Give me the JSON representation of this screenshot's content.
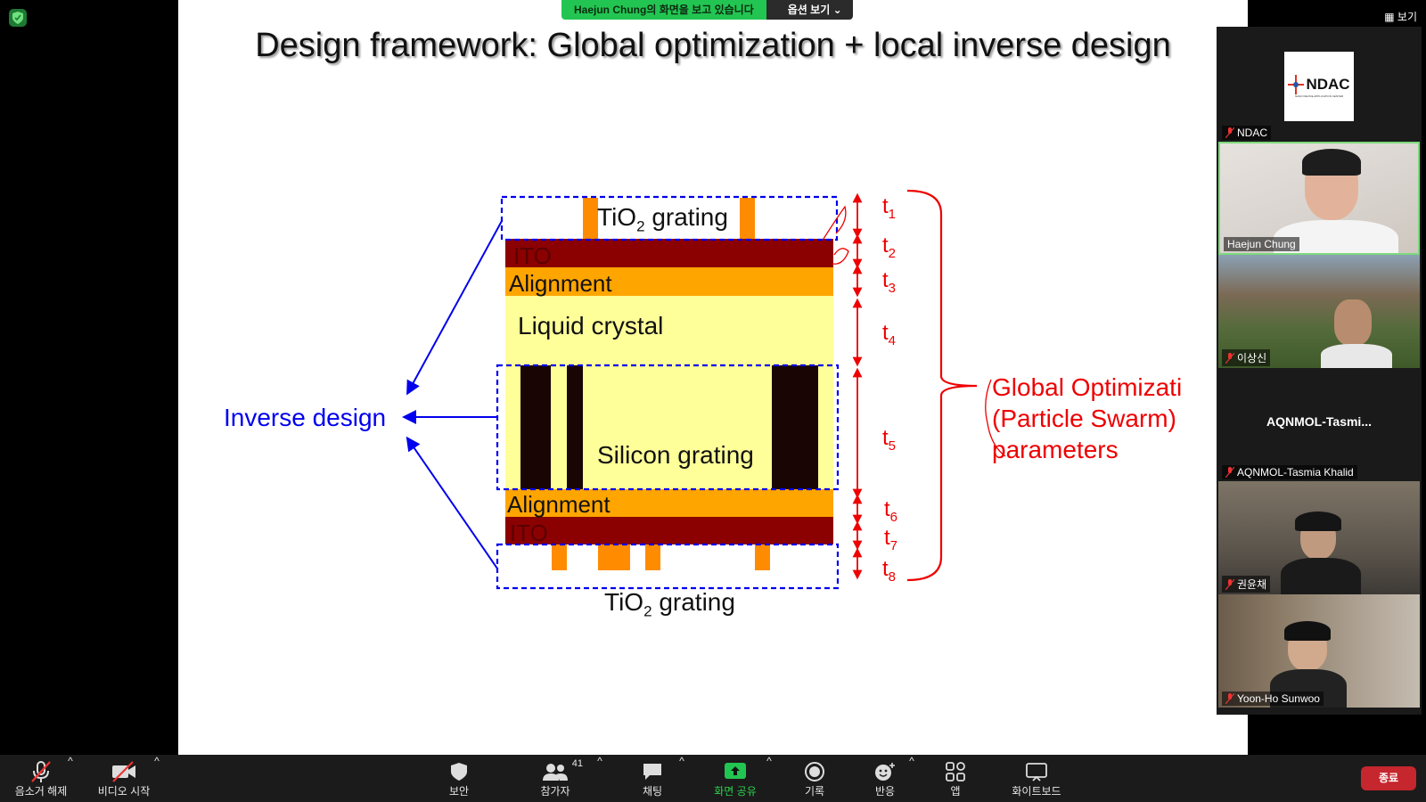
{
  "banner": {
    "share_text": "Haejun Chung의 화면을 보고 있습니다",
    "view_options": "옵션 보기"
  },
  "slide": {
    "title": "Design framework: Global optimization + local inverse design",
    "layers": {
      "tio2_top_pre": "TiO",
      "tio2_top_sub": "2",
      "tio2_top_post": " grating",
      "ito_top": "ITO",
      "alignment_top": "Alignment",
      "liquid_crystal": "Liquid crystal",
      "silicon_grating": "Silicon grating",
      "alignment_bottom": "Alignment",
      "ito_bottom": "ITO",
      "tio2_bottom_pre": "TiO",
      "tio2_bottom_sub": "2",
      "tio2_bottom_post": " grating"
    },
    "inverse_design": "Inverse design",
    "thickness": [
      "t",
      "1",
      "2",
      "3",
      "4",
      "5",
      "6",
      "7",
      "8"
    ],
    "global_opt": {
      "line1": "Global Optimizati",
      "line2": "(Particle Swarm)",
      "line3": "parameters"
    },
    "colors": {
      "ito": "#8b0000",
      "alignment": "#ffa500",
      "lc": "#ffff99",
      "tio2": "#ff8c00",
      "silicon": "#1a0505",
      "blue": "#0000ee",
      "red": "#ee0000"
    }
  },
  "gallery": {
    "view_label": "보기",
    "tiles": [
      {
        "name": "NDAC",
        "logo_text": "NDAC",
        "logo_sub": "NANO DEVICE APPLICATION CENTER"
      },
      {
        "name": "Haejun Chung"
      },
      {
        "name": "이상신"
      },
      {
        "name": "AQNMOL-Tasmia Khalid",
        "display": "AQNMOL-Tasmi..."
      },
      {
        "name": "권윤채"
      },
      {
        "name": "Yoon-Ho Sunwoo"
      }
    ]
  },
  "toolbar": {
    "mute": "음소거 해제",
    "video": "비디오 시작",
    "security": "보안",
    "participants": "참가자",
    "participants_count": "41",
    "chat": "채팅",
    "share": "화면 공유",
    "record": "기록",
    "reactions": "반응",
    "apps": "앱",
    "whiteboard": "화이트보드",
    "end": "종료"
  }
}
